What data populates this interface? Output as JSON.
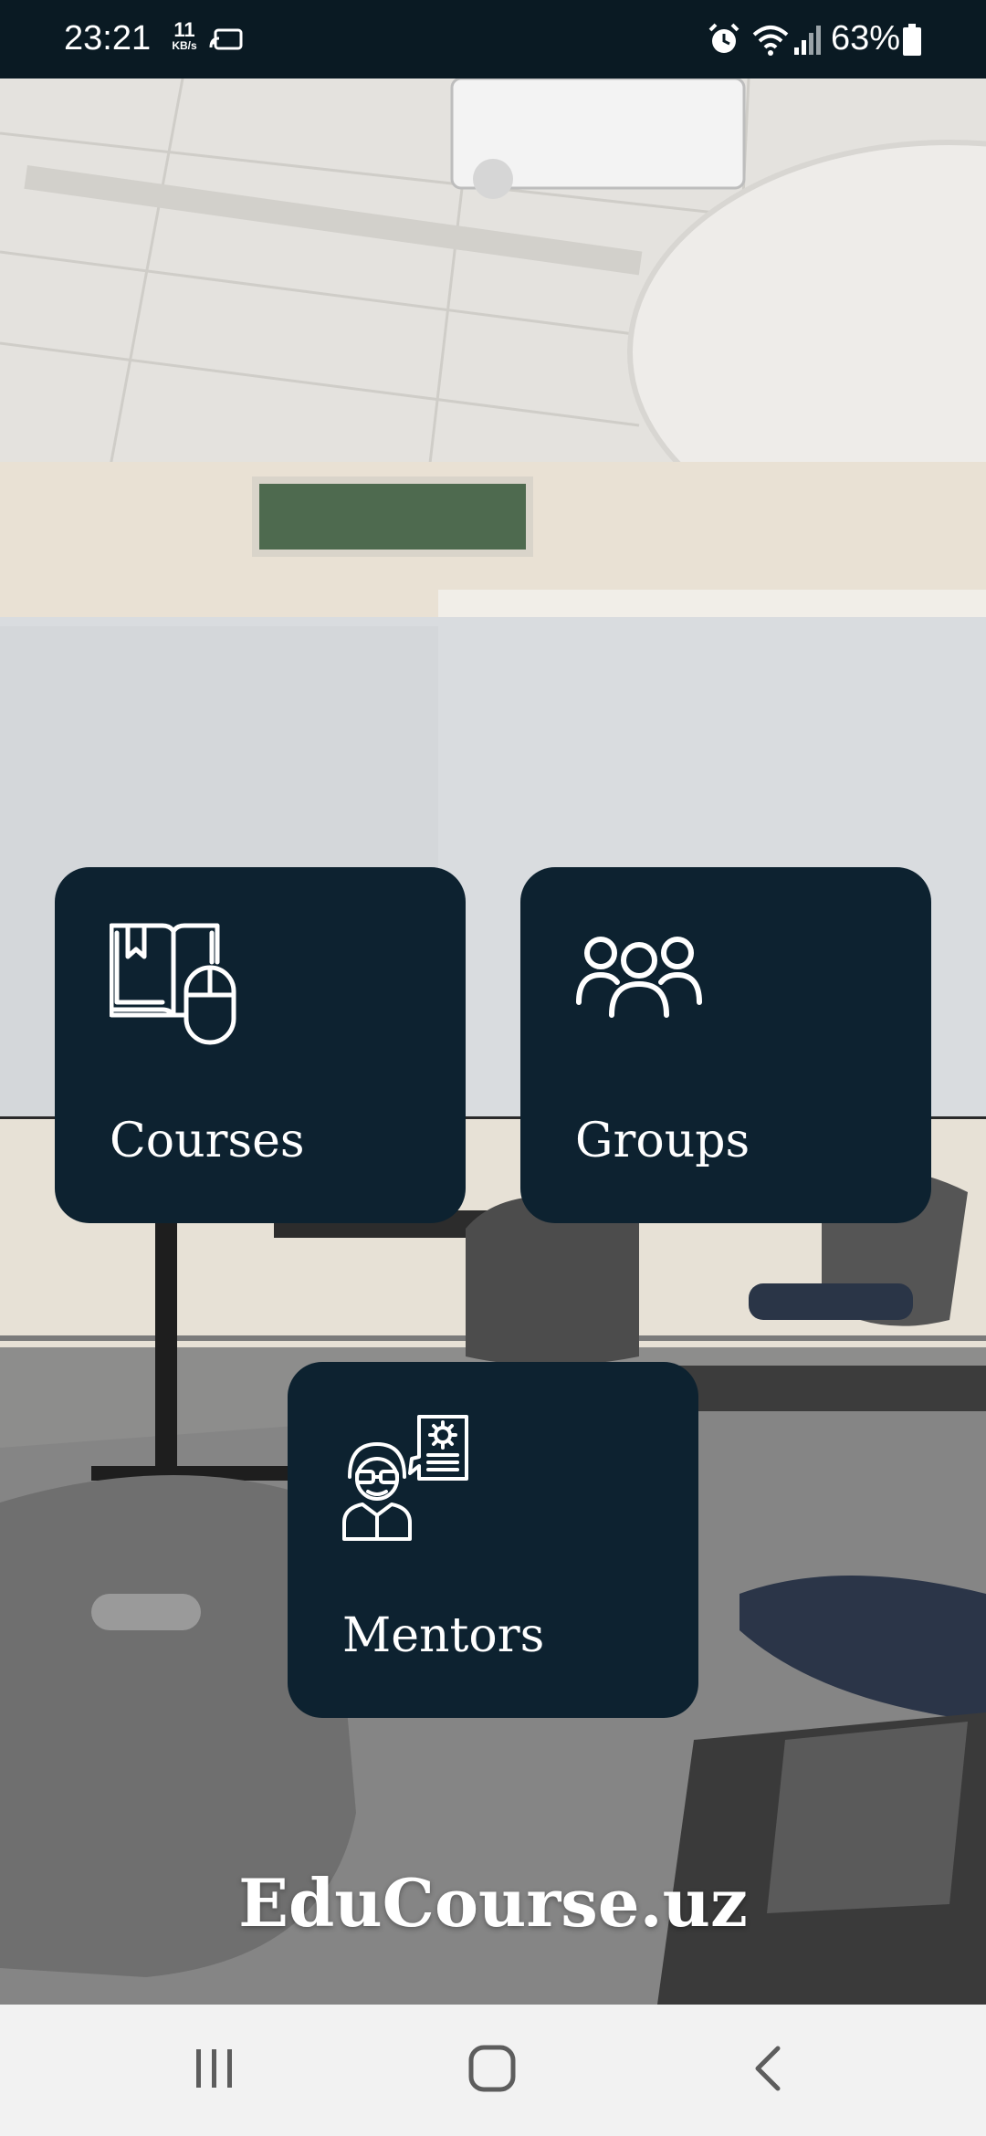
{
  "status_bar": {
    "time": "23:21",
    "net_speed_value": "11",
    "net_speed_unit": "KB/s",
    "battery_percent": "63%",
    "icons": [
      "screen-cast-icon",
      "alarm-icon",
      "wifi-icon",
      "cellular-signal-icon",
      "battery-icon"
    ]
  },
  "tiles": [
    {
      "label": "Courses",
      "icon": "book-mouse-icon"
    },
    {
      "label": "Groups",
      "icon": "group-people-icon"
    },
    {
      "label": "Mentors",
      "icon": "mentor-icon"
    }
  ],
  "app_title": "EduCourse.uz",
  "nav_bar": {
    "buttons": [
      "recent-apps-icon",
      "home-icon",
      "back-icon"
    ]
  },
  "colors": {
    "status_bar_bg": "#0a1a23",
    "tile_bg": "#0d2230",
    "nav_bar_bg": "#f2f2f2",
    "text_light": "#ffffff"
  }
}
